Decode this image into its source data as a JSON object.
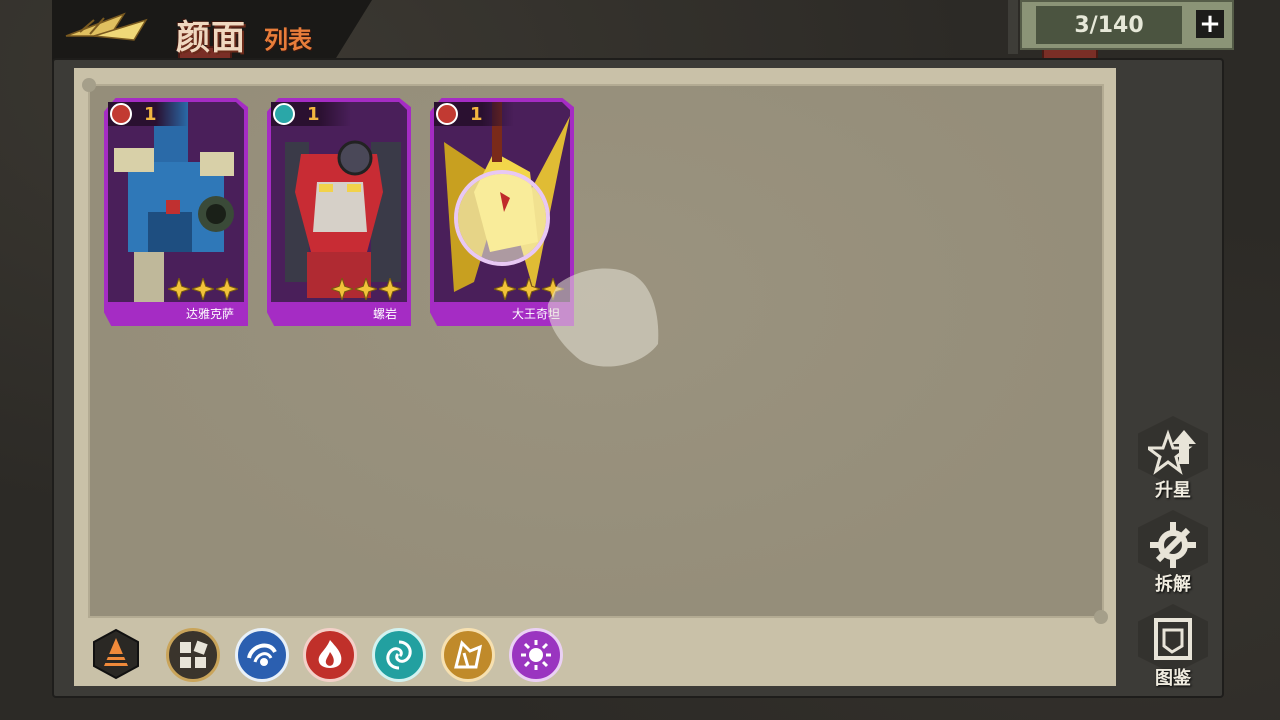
{
  "header": {
    "title_main": "颜面",
    "title_sub": "列表"
  },
  "counter": {
    "value": "3/140",
    "plus_label": "+"
  },
  "cards": [
    {
      "name": "达雅克萨",
      "level": "1",
      "element": "fire",
      "stars": 3,
      "element_color": "#c23a32"
    },
    {
      "name": "螺岩",
      "level": "1",
      "element": "wind",
      "stars": 3,
      "element_color": "#2aa7a8"
    },
    {
      "name": "大王奇坦",
      "level": "1",
      "element": "fire",
      "stars": 3,
      "element_color": "#c23a32"
    }
  ],
  "side_buttons": [
    {
      "label": "升星",
      "icon": "star-up-icon"
    },
    {
      "label": "拆解",
      "icon": "wrench-icon"
    },
    {
      "label": "图鉴",
      "icon": "book-icon"
    }
  ],
  "filters": [
    {
      "icon": "all-icon",
      "color": "#3a342c",
      "ring": "#c9a45a"
    },
    {
      "icon": "water-icon",
      "color": "#2b5fb0",
      "ring": "#e8f0f8"
    },
    {
      "icon": "fire-icon",
      "color": "#c0302a",
      "ring": "#f3d0c8"
    },
    {
      "icon": "wind-icon",
      "color": "#22a0a0",
      "ring": "#d2f2f0"
    },
    {
      "icon": "earth-icon",
      "color": "#c08a2a",
      "ring": "#f6e0b0"
    },
    {
      "icon": "light-icon",
      "color": "#9a35c0",
      "ring": "#ead0f4"
    }
  ],
  "colors": {
    "card_frame": "#a52cc4",
    "level_text": "#f2b640",
    "paper": "#c9c1a8"
  }
}
